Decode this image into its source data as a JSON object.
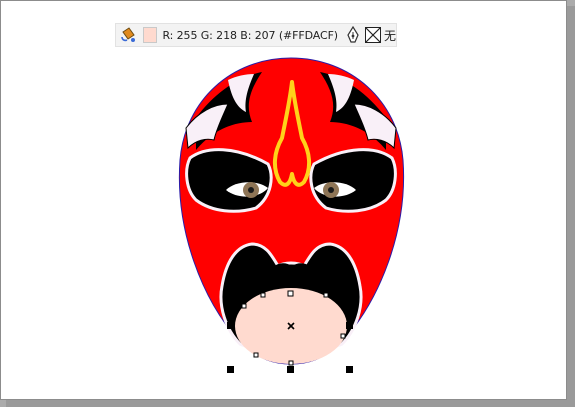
{
  "toolbar": {
    "fill_icon": "fill-bucket-icon",
    "fill_color": "#FFDACF",
    "fill_info": "R: 255 G: 218 B: 207 (#FFDACF)",
    "outline_icon": "pen-nib-icon",
    "outline_none_icon": "no-outline-icon",
    "outline_text": "无"
  },
  "canvas": {
    "artwork": "peking-opera-face-mask",
    "colors": {
      "face_red": "#FF0000",
      "black": "#000000",
      "white": "#F9F0F8",
      "gold": "#FFD21A",
      "iris": "#8E7556",
      "selected_fill": "#FFDACF",
      "outline": "#2B1BA8"
    }
  }
}
